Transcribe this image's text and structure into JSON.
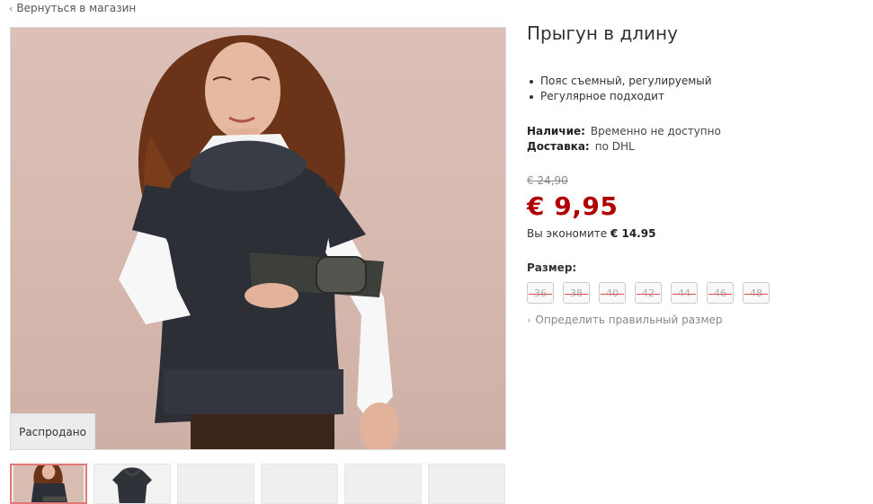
{
  "nav": {
    "back_label": "Вернуться в магазин"
  },
  "product": {
    "title": "Прыгун в длину",
    "features": [
      "Пояс съемный, регулируемый",
      "Регулярное подходит"
    ],
    "availability": {
      "label": "Наличие:",
      "value": "Временно не доступно"
    },
    "delivery": {
      "label": "Доставка:",
      "value": "по DHL"
    },
    "old_price": "€ 24,90",
    "price": "€ 9,95",
    "savings_text": "Вы экономите",
    "savings_amount": "€ 14.95",
    "size_label": "Размер:",
    "sizes": [
      "36",
      "38",
      "40",
      "42",
      "44",
      "46",
      "48"
    ],
    "size_guide_label": "Определить правильный размер"
  },
  "image": {
    "badge": "Распродано"
  },
  "colors": {
    "price_red": "#b00000",
    "badge_bg": "#ececec",
    "thumb_active_border": "#e07a78"
  }
}
